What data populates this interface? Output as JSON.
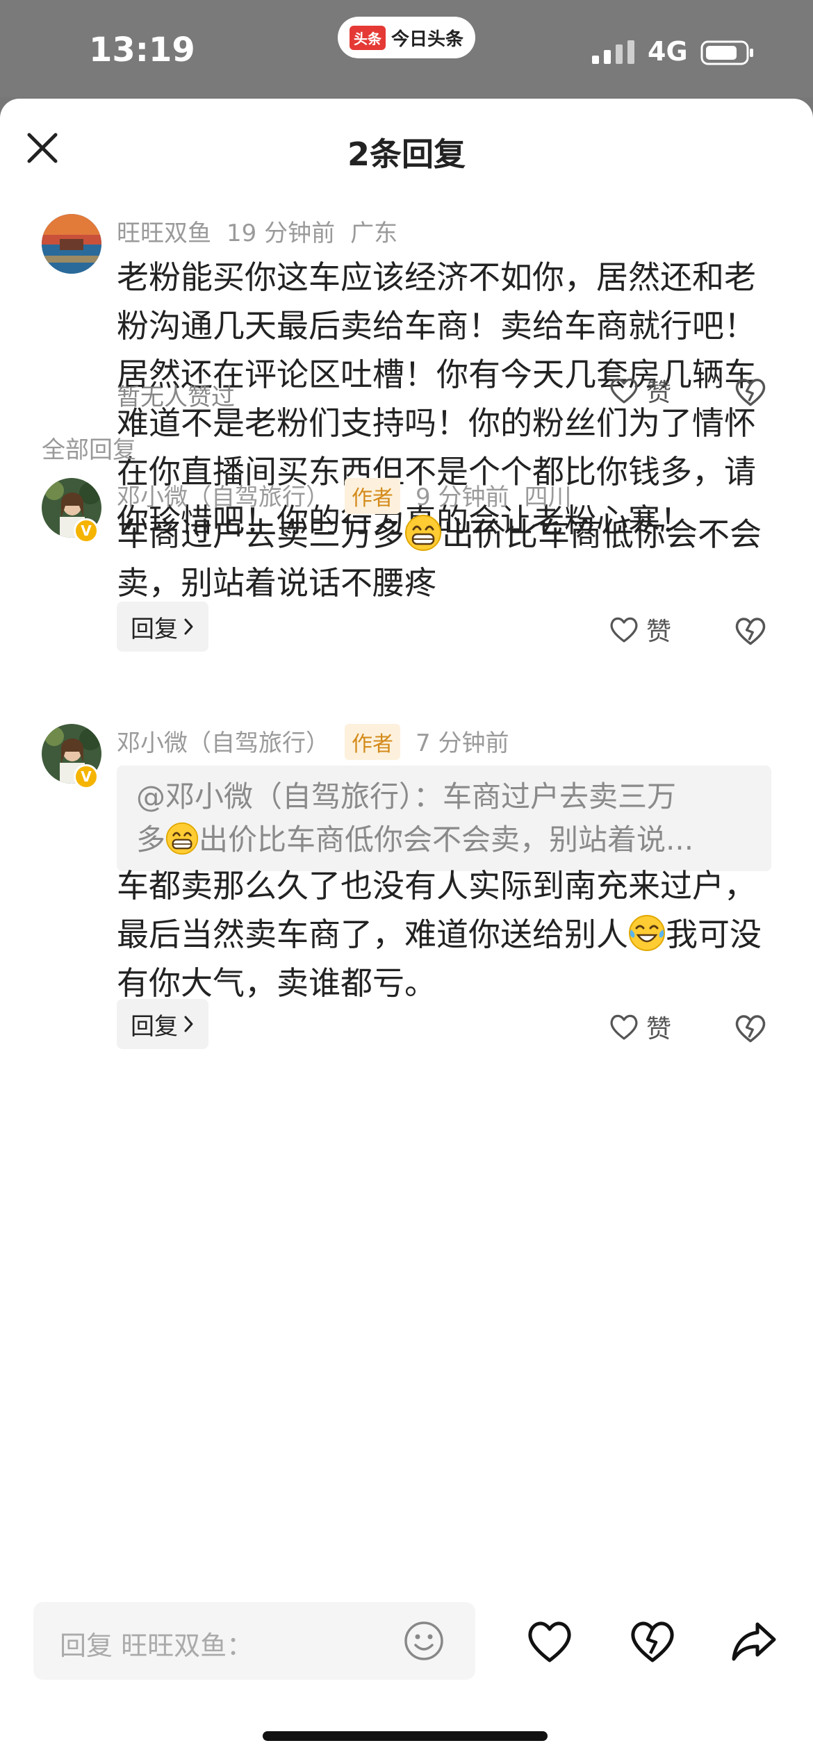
{
  "status_bar": {
    "time": "13:19",
    "app_logo": "头条",
    "app_name": "今日头条",
    "network": "4G"
  },
  "header": {
    "title": "2条回复"
  },
  "main_comment": {
    "username": "旺旺双鱼",
    "time_ago": "19 分钟前",
    "location": "广东",
    "text": "老粉能买你这车应该经济不如你，居然还和老粉沟通几天最后卖给车商！卖给车商就行吧！居然还在评论区吐槽！你有今天几套房几辆车难道不是老粉们支持吗！你的粉丝们为了情怀在你直播间买东西但不是个个都比你钱多，请你珍惜吧！你的行为真的会让老粉心寒！",
    "likes_text": "暂无人赞过",
    "like_label": "赞"
  },
  "section_label": "全部回复",
  "replies": [
    {
      "username": "邓小微（自驾旅行）",
      "author_tag": "作者",
      "time_ago": "9 分钟前",
      "location": "四川",
      "text_part1": "车商过户去卖三万多",
      "text_part2": "出价比车商低你会不会卖，别站着说话不腰疼",
      "reply_label": "回复",
      "like_label": "赞"
    },
    {
      "username": "邓小微（自驾旅行）",
      "author_tag": "作者",
      "time_ago": "7 分钟前",
      "quote_part1": "@邓小微（自驾旅行）：车商过户去卖三万",
      "quote_part2": "多",
      "quote_part3": "出价比车商低你会不会卖，别站着说...",
      "text_part1": "车都卖那么久了也没有人实际到南充来过户，最后当然卖车商了，难道你送给别人",
      "text_part2": "我可没有你大气，卖谁都亏。",
      "reply_label": "回复",
      "like_label": "赞"
    }
  ],
  "bottom_bar": {
    "placeholder": "回复 旺旺双鱼："
  },
  "colors": {
    "accent_author_bg": "#fdf1dd",
    "accent_author_text": "#d48a1a",
    "verified_badge": "#f5b400"
  }
}
